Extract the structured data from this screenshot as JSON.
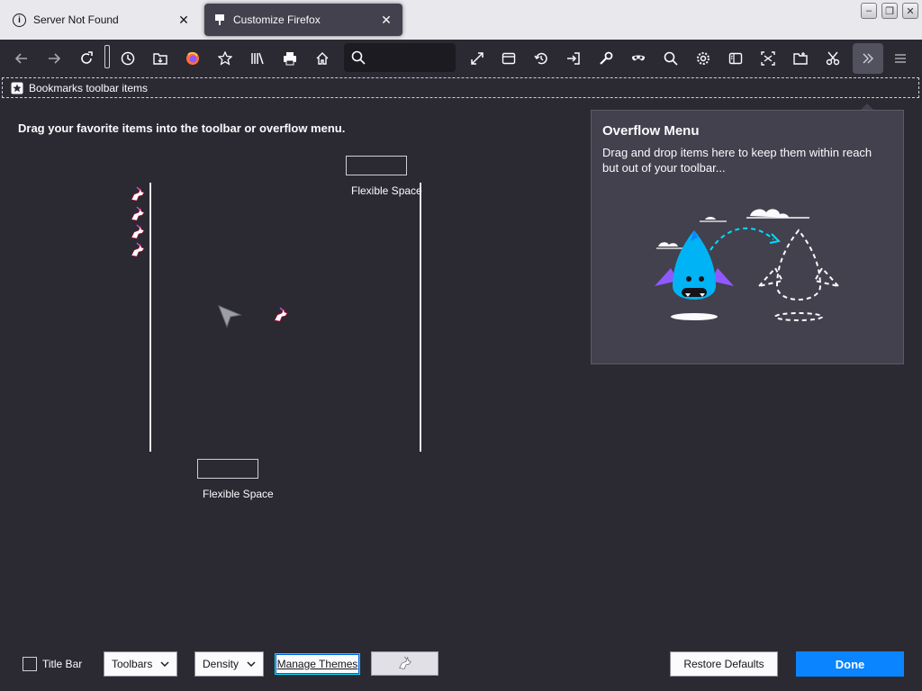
{
  "tabs": [
    {
      "label": "Server Not Found",
      "icon": "info-icon",
      "close": "✕"
    },
    {
      "label": "Customize Firefox",
      "icon": "customize-pin-icon",
      "close": "✕"
    }
  ],
  "window_controls": {
    "minimize": "‒",
    "restore": "❐",
    "close": "✕"
  },
  "toolbar": {
    "items": [
      "back-icon",
      "forward-icon",
      "reload-icon",
      "flexible-space",
      "history-icon",
      "downloads-icon",
      "firefox-account-icon",
      "bookmarks-star-icon",
      "library-icon",
      "print-icon",
      "home-icon",
      "search-icon",
      "fullscreen-icon",
      "new-window-icon",
      "history-restore-icon",
      "sign-in-icon",
      "developer-tools-icon",
      "private-window-icon",
      "find-icon",
      "settings-icon",
      "sidebar-icon",
      "screenshot-icon",
      "save-page-icon",
      "cut-icon",
      "overflow-chevron-icon",
      "app-menu-icon"
    ]
  },
  "bookmarks_toolbar": {
    "label": "Bookmarks toolbar items"
  },
  "palette": {
    "instruction": "Drag your favorite items into the toolbar or overflow menu.",
    "flexible_space_1": "Flexible Space",
    "flexible_space_2": "Flexible Space"
  },
  "overflow_menu": {
    "title": "Overflow Menu",
    "description": "Drag and drop items here to keep them within reach but out of your toolbar..."
  },
  "footer": {
    "title_bar": "Title Bar",
    "toolbars": "Toolbars",
    "density": "Density",
    "manage_themes": "Manage Themes",
    "restore_defaults": "Restore Defaults",
    "done": "Done"
  },
  "colors": {
    "accent": "#0a84ff",
    "background": "#2b2a33",
    "panel": "#42414d",
    "dragon": "#00b3f4",
    "wings": "#9059ff"
  }
}
